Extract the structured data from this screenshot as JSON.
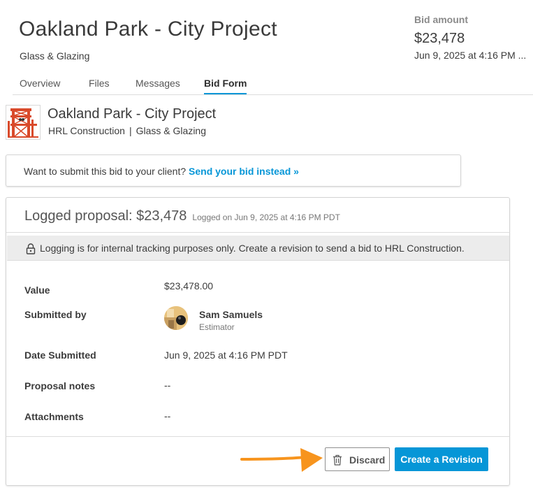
{
  "header": {
    "title": "Oakland Park - City Project",
    "subtitle": "Glass & Glazing",
    "bid_amount_label": "Bid amount",
    "bid_amount_value": "$23,478",
    "bid_amount_date": "Jun 9, 2025 at 4:16 PM ..."
  },
  "tabs": [
    {
      "label": "Overview",
      "active": false
    },
    {
      "label": "Files",
      "active": false
    },
    {
      "label": "Messages",
      "active": false
    },
    {
      "label": "Bid Form",
      "active": true
    }
  ],
  "project": {
    "name": "Oakland Park - City Project",
    "company": "HRL Construction",
    "separator": "|",
    "trade": "Glass & Glazing",
    "logo_icon": "bridge-logo-icon"
  },
  "notice": {
    "text": "Want to submit this bid to your client? ",
    "link": "Send your bid instead »"
  },
  "proposal": {
    "title": "Logged proposal: $23,478",
    "logged_on": "Logged on Jun 9, 2025 at 4:16 PM PDT",
    "banner_text": "Logging is for internal tracking purposes only. Create a revision to send a bid to HRL Construction.",
    "rows": {
      "value_label": "Value",
      "value": "$23,478.00",
      "submitted_by_label": "Submitted by",
      "submitter_name": "Sam Samuels",
      "submitter_role": "Estimator",
      "date_label": "Date Submitted",
      "date_value": "Jun 9, 2025 at 4:16 PM PDT",
      "notes_label": "Proposal notes",
      "notes_value": "--",
      "attachments_label": "Attachments",
      "attachments_value": "--"
    },
    "buttons": {
      "discard": "Discard",
      "create_revision": "Create a Revision"
    }
  },
  "colors": {
    "accent": "#0696d7",
    "arrow": "#f7941d",
    "logo": "#d94a2b"
  }
}
